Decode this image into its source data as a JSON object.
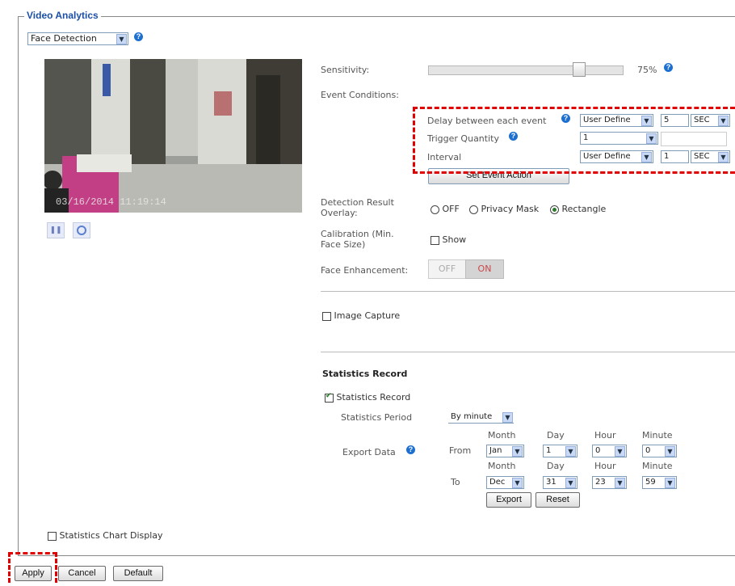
{
  "section_title": "Video Analytics",
  "analytics_select": "Face Detection",
  "video": {
    "timestamp": "03/16/2014  11:19:14"
  },
  "sensitivity": {
    "label": "Sensitivity:",
    "value_text": "75%",
    "level": 0.75
  },
  "event_conditions": {
    "label": "Event Conditions:",
    "delay": {
      "label": "Delay between each event",
      "mode": "User Define",
      "value": "5",
      "unit": "SEC"
    },
    "trigger": {
      "label": "Trigger Quantity",
      "value": "1"
    },
    "interval": {
      "label": "Interval",
      "mode": "User Define",
      "value": "1",
      "unit": "SEC"
    },
    "set_action_button": "Set Event Action"
  },
  "overlay": {
    "label_line1": "Detection Result",
    "label_line2": "Overlay:",
    "options": [
      "OFF",
      "Privacy Mask",
      "Rectangle"
    ],
    "selected": "Rectangle"
  },
  "calibration": {
    "label_line1": "Calibration (Min.",
    "label_line2": "Face Size)",
    "show_label": "Show"
  },
  "face_enhancement": {
    "label": "Face Enhancement:",
    "off": "OFF",
    "on": "ON"
  },
  "image_capture": {
    "label": "Image Capture"
  },
  "statistics": {
    "heading": "Statistics Record",
    "record_label": "Statistics Record",
    "period_label": "Statistics Period",
    "period_value": "By minute",
    "export_label": "Export Data",
    "headers": {
      "month": "Month",
      "day": "Day",
      "hour": "Hour",
      "minute": "Minute"
    },
    "from": {
      "label": "From",
      "month": "Jan",
      "day": "1",
      "hour": "0",
      "minute": "0"
    },
    "to": {
      "label": "To",
      "month": "Dec",
      "day": "31",
      "hour": "23",
      "minute": "59"
    },
    "export_button": "Export",
    "reset_button": "Reset"
  },
  "chart_display": {
    "label": "Statistics Chart Display"
  },
  "footer": {
    "apply": "Apply",
    "cancel": "Cancel",
    "default": "Default"
  },
  "colors": {
    "accent": "#1b4fa5",
    "highlight_dash": "#e00000",
    "on_button": "#c9474b"
  }
}
